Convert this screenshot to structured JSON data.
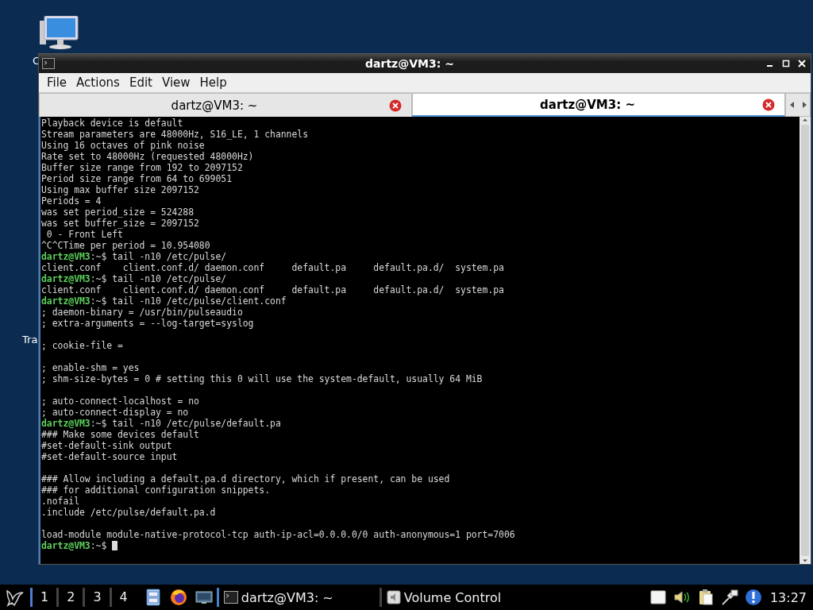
{
  "desktop_icons": [
    {
      "label": "C"
    },
    {
      "label": "Tra"
    }
  ],
  "window": {
    "title": "dartz@VM3: ~"
  },
  "menu": [
    "File",
    "Actions",
    "Edit",
    "View",
    "Help"
  ],
  "tabs": [
    {
      "label": "dartz@VM3: ~",
      "selected": false
    },
    {
      "label": "dartz@VM3: ~",
      "selected": true
    }
  ],
  "terminal": {
    "lines": [
      {
        "kind": "output",
        "text": "Playback device is default"
      },
      {
        "kind": "output",
        "text": "Stream parameters are 48000Hz, S16_LE, 1 channels"
      },
      {
        "kind": "output",
        "text": "Using 16 octaves of pink noise"
      },
      {
        "kind": "output",
        "text": "Rate set to 48000Hz (requested 48000Hz)"
      },
      {
        "kind": "output",
        "text": "Buffer size range from 192 to 2097152"
      },
      {
        "kind": "output",
        "text": "Period size range from 64 to 699051"
      },
      {
        "kind": "output",
        "text": "Using max buffer size 2097152"
      },
      {
        "kind": "output",
        "text": "Periods = 4"
      },
      {
        "kind": "output",
        "text": "was set period_size = 524288"
      },
      {
        "kind": "output",
        "text": "was set buffer_size = 2097152"
      },
      {
        "kind": "output",
        "text": " 0 - Front Left"
      },
      {
        "kind": "output",
        "text": "^C^CTime per period = 10.954080"
      },
      {
        "kind": "prompt",
        "prompt": "dartz@VM3",
        "cwd": ":~$",
        "command": "tail -n10 /etc/pulse/"
      },
      {
        "kind": "output",
        "text": "client.conf    client.conf.d/ daemon.conf     default.pa     default.pa.d/  system.pa"
      },
      {
        "kind": "prompt",
        "prompt": "dartz@VM3",
        "cwd": ":~$",
        "command": "tail -n10 /etc/pulse/"
      },
      {
        "kind": "output",
        "text": "client.conf    client.conf.d/ daemon.conf     default.pa     default.pa.d/  system.pa"
      },
      {
        "kind": "prompt",
        "prompt": "dartz@VM3",
        "cwd": ":~$",
        "command": "tail -n10 /etc/pulse/client.conf"
      },
      {
        "kind": "output",
        "text": "; daemon-binary = /usr/bin/pulseaudio"
      },
      {
        "kind": "output",
        "text": "; extra-arguments = --log-target=syslog"
      },
      {
        "kind": "blank"
      },
      {
        "kind": "output",
        "text": "; cookie-file ="
      },
      {
        "kind": "blank"
      },
      {
        "kind": "output",
        "text": "; enable-shm = yes"
      },
      {
        "kind": "output",
        "text": "; shm-size-bytes = 0 # setting this 0 will use the system-default, usually 64 MiB"
      },
      {
        "kind": "blank"
      },
      {
        "kind": "output",
        "text": "; auto-connect-localhost = no"
      },
      {
        "kind": "output",
        "text": "; auto-connect-display = no"
      },
      {
        "kind": "prompt",
        "prompt": "dartz@VM3",
        "cwd": ":~$",
        "command": "tail -n10 /etc/pulse/default.pa"
      },
      {
        "kind": "output",
        "text": "### Make some devices default"
      },
      {
        "kind": "output",
        "text": "#set-default-sink output"
      },
      {
        "kind": "output",
        "text": "#set-default-source input"
      },
      {
        "kind": "blank"
      },
      {
        "kind": "output",
        "text": "### Allow including a default.pa.d directory, which if present, can be used"
      },
      {
        "kind": "output",
        "text": "### for additional configuration snippets."
      },
      {
        "kind": "output",
        "text": ".nofail"
      },
      {
        "kind": "output",
        "text": ".include /etc/pulse/default.pa.d"
      },
      {
        "kind": "blank"
      },
      {
        "kind": "output",
        "text": "load-module module-native-protocol-tcp auth-ip-acl=0.0.0.0/0 auth-anonymous=1 port=7006"
      },
      {
        "kind": "prompt",
        "prompt": "dartz@VM3",
        "cwd": ":~$",
        "cursor": true
      }
    ]
  },
  "taskbar": {
    "workspaces": [
      {
        "label": "1",
        "selected": true
      },
      {
        "label": "2",
        "selected": false
      },
      {
        "label": "3",
        "selected": false
      },
      {
        "label": "4",
        "selected": false
      }
    ],
    "tasks": [
      {
        "label": "dartz@VM3: ~",
        "kind": "terminal",
        "selected": true
      },
      {
        "label": "Volume Control",
        "kind": "volume",
        "selected": false
      }
    ],
    "clock": "13:27"
  }
}
